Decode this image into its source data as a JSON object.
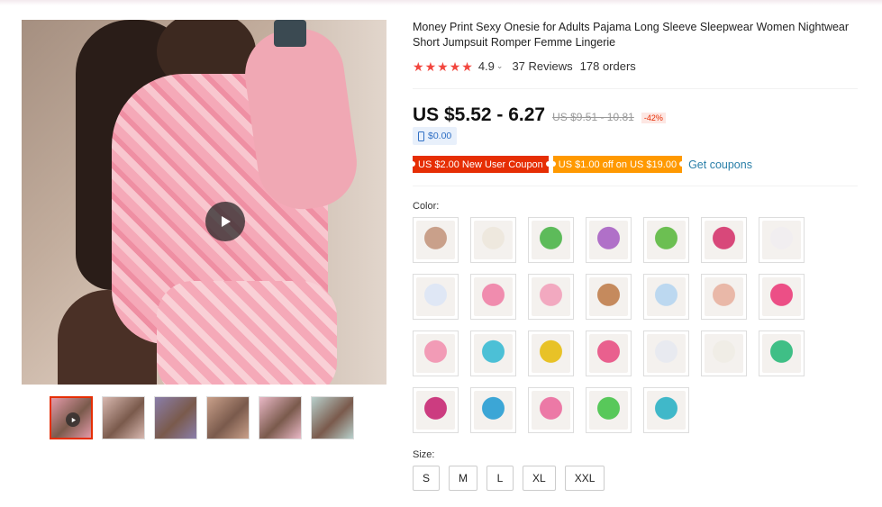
{
  "product": {
    "title": "Money Print Sexy Onesie for Adults Pajama Long Sleeve Sleepwear Women Nightwear Short Jumpsuit Romper Femme Lingerie",
    "rating_value": "4.9",
    "reviews_text": "37 Reviews",
    "orders_text": "178 orders"
  },
  "price": {
    "current": "US $5.52 - 6.27",
    "original": "US $9.51 - 10.81",
    "discount": "-42%",
    "app_price": "$0.00"
  },
  "coupons": {
    "new_user": "US $2.00 New User Coupon",
    "off": "US $1.00 off on US $19.00",
    "get_coupons": "Get coupons"
  },
  "color": {
    "label": "Color:",
    "swatch_colors": [
      "#c9a08a",
      "#eee8de",
      "#5dbb5a",
      "#b070c8",
      "#6cbf52",
      "#d8487a",
      "#f1eef0",
      "#dfe7f5",
      "#f08cae",
      "#f2a9c0",
      "#c58a5d",
      "#bcd8f0",
      "#e9b8a8",
      "#ec4f86",
      "#f29bb6",
      "#4cc0d6",
      "#e8c227",
      "#e9608e",
      "#e8eaf0",
      "#f0ede6",
      "#3fbf86",
      "#cc3c80",
      "#3ca6d6",
      "#ec79a6",
      "#58c85a",
      "#40b8c9"
    ]
  },
  "size": {
    "label": "Size:",
    "options": [
      "S",
      "M",
      "L",
      "XL",
      "XXL"
    ]
  },
  "thumbnails": {
    "colors": [
      "#e39aa8",
      "#d8b8b0",
      "#8a7eaa",
      "#c9a08a",
      "#e9b8c6",
      "#b8d0cc"
    ]
  }
}
